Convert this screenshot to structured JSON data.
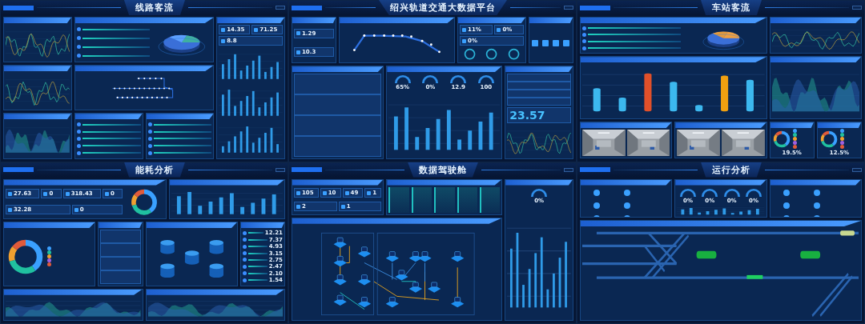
{
  "screens": [
    {
      "title": "线路客流",
      "panels": [
        {
          "kind": "line"
        },
        {
          "kind": "pie"
        },
        {
          "kind": "line"
        },
        {
          "kind": "map"
        },
        {
          "kind": "area"
        },
        {
          "kind": "list"
        },
        {
          "kind": "list"
        },
        {
          "kind": "tiles-bars",
          "values": [
            "14.35",
            "71.25",
            "8.8"
          ]
        }
      ]
    },
    {
      "title": "绍兴轨道交通大数据平台",
      "panels": [
        {
          "kind": "tiles",
          "values": [
            "1.29",
            "10.3"
          ]
        },
        {
          "kind": "route"
        },
        {
          "kind": "rings",
          "values": [
            "11%",
            "0%",
            "0%"
          ]
        },
        {
          "kind": "icons"
        },
        {
          "kind": "table"
        },
        {
          "kind": "gauges",
          "values": [
            "65%",
            "0%",
            "12.9",
            "100"
          ]
        },
        {
          "kind": "stat",
          "values": [
            "23.57"
          ]
        }
      ]
    },
    {
      "title": "车站客流",
      "panels": [
        {
          "kind": "pie"
        },
        {
          "kind": "cylinders"
        },
        {
          "kind": "camera"
        },
        {
          "kind": "camera"
        },
        {
          "kind": "line"
        },
        {
          "kind": "area"
        },
        {
          "kind": "donut",
          "values": [
            "19.5%"
          ]
        },
        {
          "kind": "donut",
          "values": [
            "12.5%"
          ]
        }
      ]
    },
    {
      "title": "能耗分析",
      "panels": [
        {
          "kind": "tiles-donut",
          "values": [
            "27.63",
            "0",
            "318.43",
            "0",
            "32.28",
            "0"
          ]
        },
        {
          "kind": "bars"
        },
        {
          "kind": "donut"
        },
        {
          "kind": "table"
        },
        {
          "kind": "iso"
        },
        {
          "kind": "list",
          "values": [
            "12.21",
            "7.37",
            "4.93",
            "3.15",
            "2.75",
            "2.47",
            "2.10",
            "1.54"
          ]
        },
        {
          "kind": "area"
        },
        {
          "kind": "area"
        }
      ]
    },
    {
      "title": "数据驾驶舱",
      "panels": [
        {
          "kind": "tiles",
          "values": [
            "105",
            "10",
            "49",
            "1",
            "2",
            "1"
          ]
        },
        {
          "kind": "cards"
        },
        {
          "kind": "gauges",
          "values": [
            "0%"
          ]
        },
        {
          "kind": "network"
        }
      ]
    },
    {
      "title": "运行分析",
      "panels": [
        {
          "kind": "tiles"
        },
        {
          "kind": "gauges",
          "values": [
            "0%",
            "0%",
            "0%",
            "0%"
          ]
        },
        {
          "kind": "tiles"
        },
        {
          "kind": "track"
        }
      ]
    }
  ]
}
